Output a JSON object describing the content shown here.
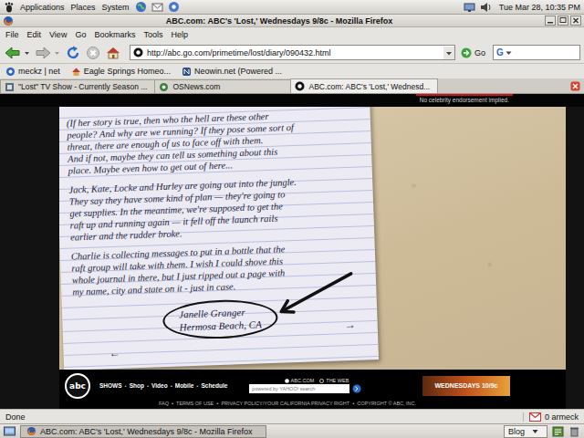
{
  "top_panel": {
    "menus": [
      "Applications",
      "Places",
      "System"
    ],
    "clock": "Tue Mar 28, 10:35 PM"
  },
  "window": {
    "title": "ABC.com: ABC's 'Lost,' Wednesdays 9/8c - Mozilla Firefox"
  },
  "menubar": [
    "File",
    "Edit",
    "View",
    "Go",
    "Bookmarks",
    "Tools",
    "Help"
  ],
  "toolbar": {
    "url": "http://abc.go.com/primetime/lost/diary/090432.html",
    "go": "Go",
    "search_engine": "G"
  },
  "bookmarks": [
    "meckz | net",
    "Eagle Springs Homeo...",
    "Neowin.net (Powered ..."
  ],
  "tabs": [
    {
      "label": "\"Lost\" TV Show - Currently Season ...",
      "selected": false
    },
    {
      "label": "OSNews.com",
      "selected": false
    },
    {
      "label": "ABC.com: ABC's 'Lost,' Wednesd...",
      "selected": true
    }
  ],
  "page": {
    "disclaimer": "No celebrity endorsement implied.",
    "diary": {
      "paragraphs": [
        [
          "(If her story is true, then who the hell are these other",
          "people? And why are we running? If they pose some sort of",
          "threat, there are enough of us to face off with them.",
          "And if not, maybe they can tell us something about this",
          "place. Maybe even how to get out of here..."
        ],
        [
          "Jack, Kate, Locke and Hurley are going out into the jungle.",
          "They say they have some kind of plan — they're going to",
          "get supplies. In the meantime, we're supposed to get the",
          "raft up and running again — it fell off the launch rails",
          "earlier and the rudder broke."
        ],
        [
          "Charlie is collecting messages to put in a bottle that the",
          "raft group will take with them. I wish I could shove this",
          "whole journal in there, but I just ripped out a page with",
          "my name, city and state on it - just in case."
        ]
      ],
      "signature": [
        "Janelle Granger",
        "Hermosa Beach, CA"
      ],
      "next_arrow": "→",
      "prev_arrow": "←"
    },
    "footer": {
      "logo": "abc",
      "nav": [
        "SHOWS",
        "Shop",
        "Video",
        "Mobile",
        "Schedule"
      ],
      "separator": "•",
      "search_scopes": [
        {
          "label": "ABC.COM",
          "selected": true
        },
        {
          "label": "THE WEB",
          "selected": false
        }
      ],
      "search_placeholder": "powered by YAHOO! search",
      "banner": "WEDNESDAYS 10/9c",
      "legal": [
        "FAQ",
        "TERMS OF USE",
        "PRIVACY POLICY/YOUR CALIFORNIA PRIVACY RIGHT",
        "COPYRIGHT © ABC, INC."
      ]
    }
  },
  "status_bar": {
    "text": "Done",
    "mail": "0 armeck"
  },
  "taskbar": {
    "items": [
      {
        "label": "ABC.com: ABC's 'Lost,' Wednesdays 9/8c - Mozilla Firefox",
        "selected": true
      }
    ],
    "blog": "Blog"
  }
}
